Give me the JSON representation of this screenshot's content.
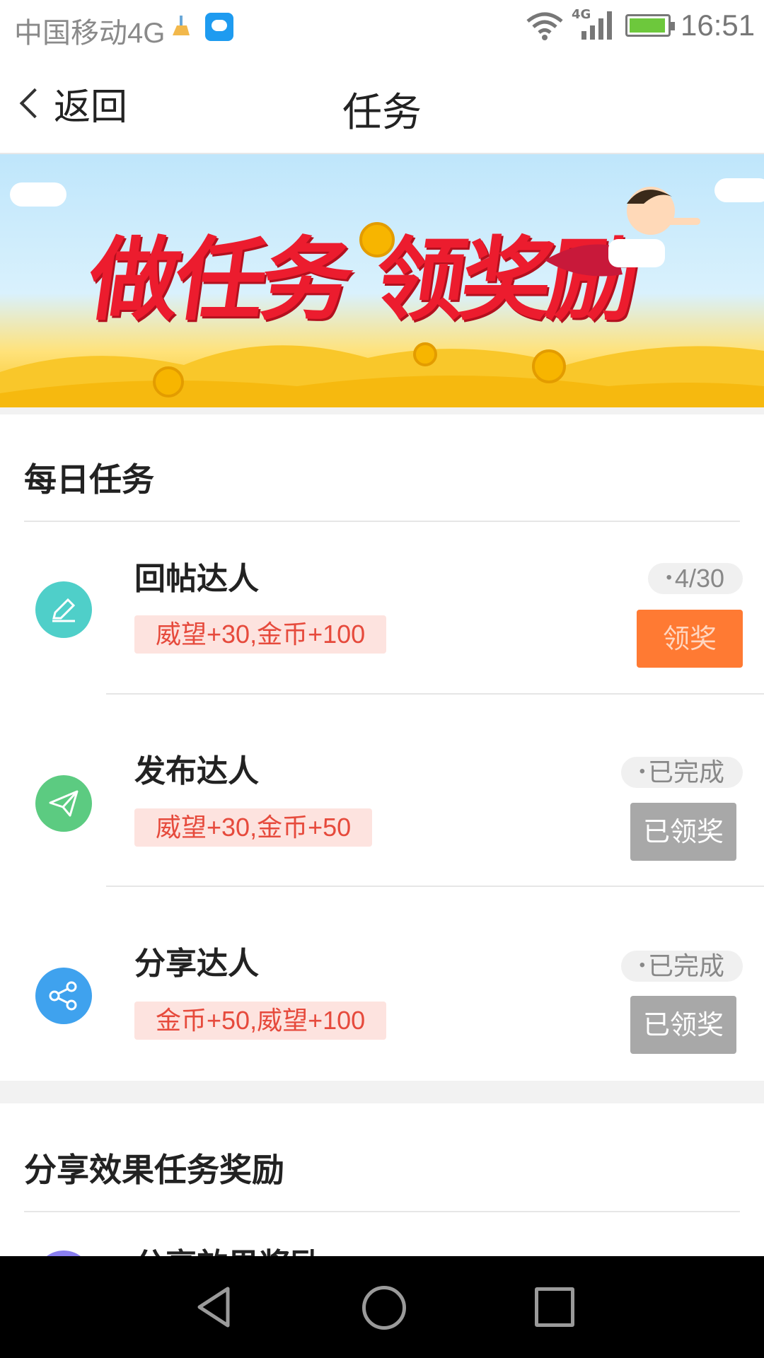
{
  "status_bar": {
    "carrier": "中国移动4G",
    "network": "4G",
    "time": "16:51"
  },
  "nav": {
    "back_label": "返回",
    "title": "任务"
  },
  "banner": {
    "headline": "做任务 领奖励"
  },
  "daily": {
    "title": "每日任务",
    "tasks": [
      {
        "name": "回帖达人",
        "reward": "威望+30,金币+100",
        "status": "4/30",
        "button": "领奖",
        "icon": "pencil-icon",
        "icon_color": "#4fcfc9"
      },
      {
        "name": "发布达人",
        "reward": "威望+30,金币+50",
        "status": "已完成",
        "button": "已领奖",
        "icon": "paper-plane-icon",
        "icon_color": "#5ccb81"
      },
      {
        "name": "分享达人",
        "reward": "金币+50,威望+100",
        "status": "已完成",
        "button": "已领奖",
        "icon": "share-icon",
        "icon_color": "#3fa2ee"
      }
    ]
  },
  "share_effect": {
    "title": "分享效果任务奖励",
    "first_item": "分享效果奖励"
  },
  "colors": {
    "accent_orange": "#ff7a33",
    "reward_text": "#e64a3c",
    "reward_bg": "#fde3df",
    "claimed_grey": "#a8a8a8"
  }
}
